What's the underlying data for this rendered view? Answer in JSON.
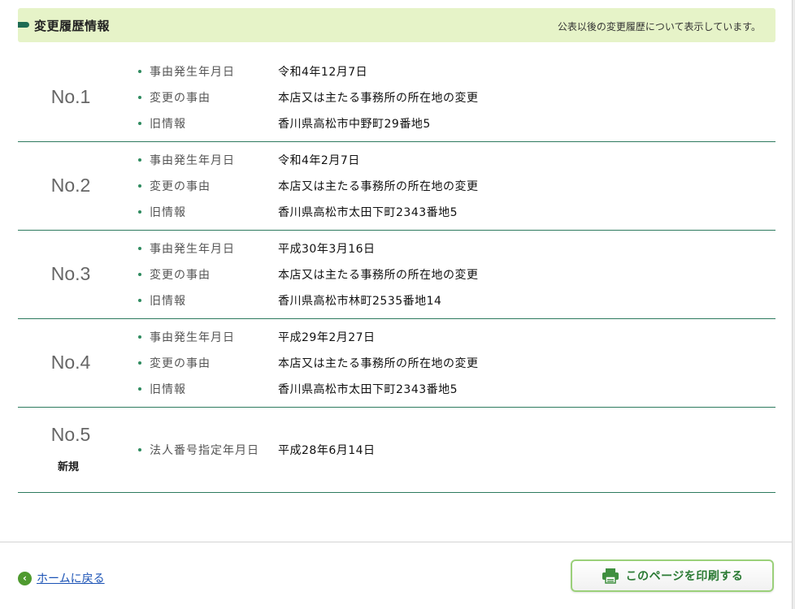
{
  "section": {
    "title": "変更履歴情報",
    "note": "公表以後の変更履歴について表示しています。"
  },
  "labels": {
    "date": "事由発生年月日",
    "reason": "変更の事由",
    "old_info": "旧情報"
  },
  "records": [
    {
      "no": "No.1",
      "date": "令和4年12月7日",
      "reason": "本店又は主たる事務所の所在地の変更",
      "old_info": "香川県高松市中野町29番地5"
    },
    {
      "no": "No.2",
      "date": "令和4年2月7日",
      "reason": "本店又は主たる事務所の所在地の変更",
      "old_info": "香川県高松市太田下町2343番地5"
    },
    {
      "no": "No.3",
      "date": "平成30年3月16日",
      "reason": "本店又は主たる事務所の所在地の変更",
      "old_info": "香川県高松市林町2535番地14"
    },
    {
      "no": "No.4",
      "date": "平成29年2月27日",
      "reason": "本店又は主たる事務所の所在地の変更",
      "old_info": "香川県高松市太田下町2343番地5"
    },
    {
      "no": "No.5",
      "sub": "新規",
      "label": "法人番号指定年月日",
      "value": "平成28年6月14日"
    }
  ],
  "footer": {
    "home_label": "ホームに戻る",
    "home_icon": "chevron-left-circle-icon",
    "print_label": "このページを印刷する",
    "print_icon": "printer-icon"
  },
  "colors": {
    "header_bg": "#e6f3c8",
    "accent_green": "#2d7a5e",
    "link_blue": "#1a52b5",
    "print_text": "#2a7a33"
  }
}
